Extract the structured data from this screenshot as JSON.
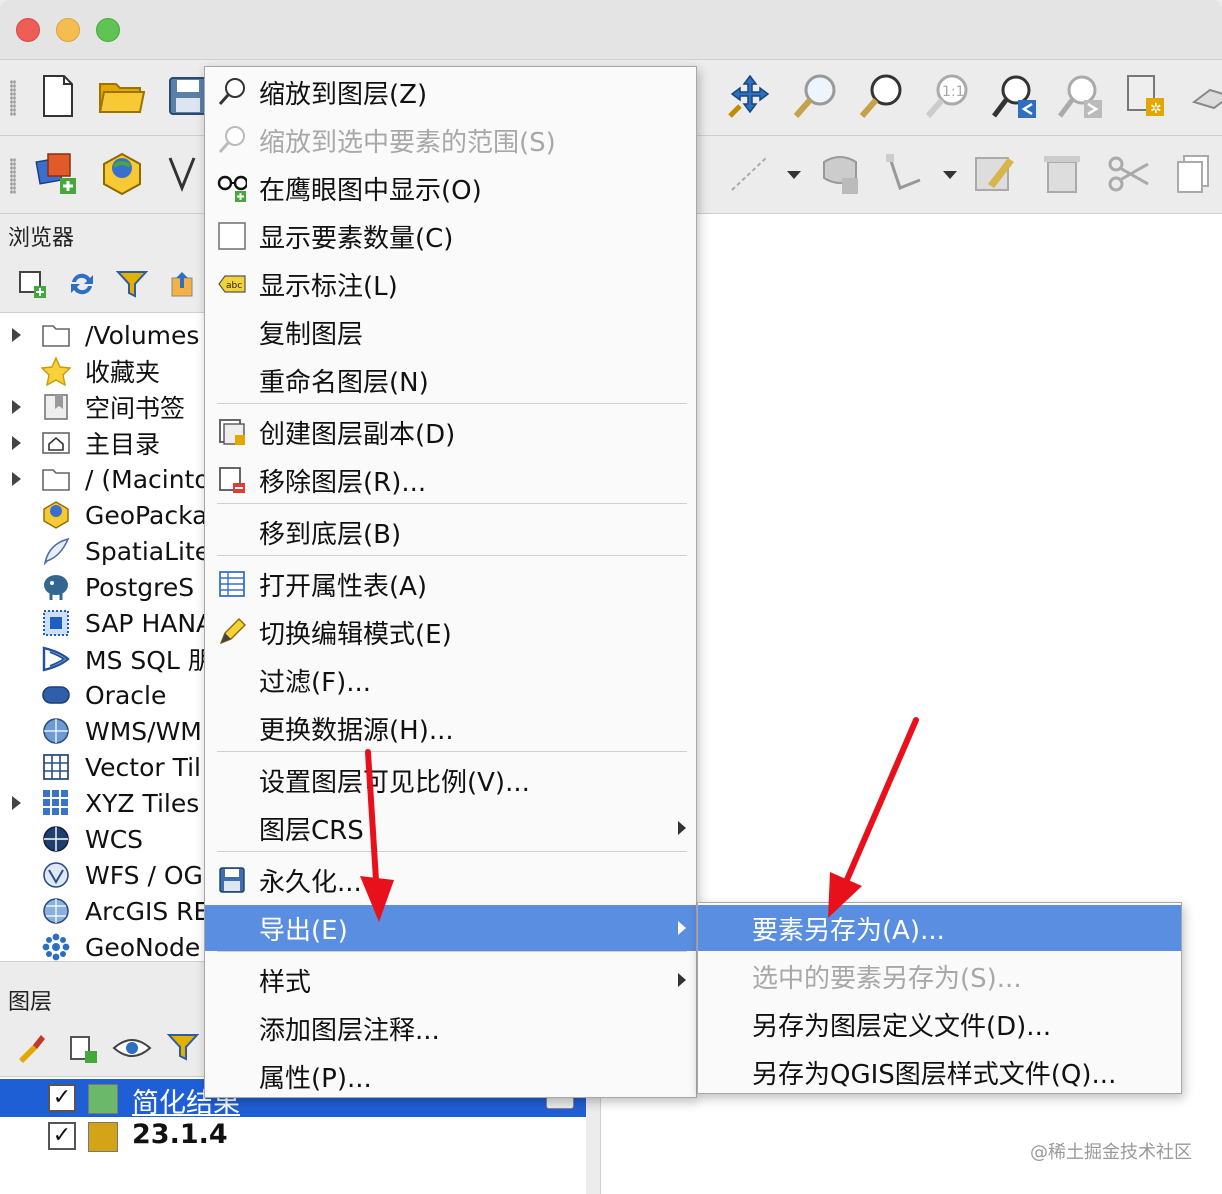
{
  "browser": {
    "title": "浏览器",
    "items": [
      {
        "label": "/Volumes",
        "icon": "folder-icon",
        "arrow": true
      },
      {
        "label": "收藏夹",
        "icon": "star-icon",
        "arrow": false
      },
      {
        "label": "空间书签",
        "icon": "bookmark-icon",
        "arrow": true
      },
      {
        "label": "主目录",
        "icon": "home-icon",
        "arrow": true
      },
      {
        "label": "/ (Macinto",
        "icon": "folder-icon",
        "arrow": true
      },
      {
        "label": "GeoPacka",
        "icon": "geopackage-icon",
        "arrow": false
      },
      {
        "label": "SpatiaLite",
        "icon": "feather-icon",
        "arrow": false
      },
      {
        "label": "PostgreS",
        "icon": "elephant-icon",
        "arrow": false
      },
      {
        "label": "SAP HANA",
        "icon": "hana-icon",
        "arrow": false
      },
      {
        "label": "MS SQL 朋",
        "icon": "mssql-icon",
        "arrow": false
      },
      {
        "label": "Oracle",
        "icon": "oracle-icon",
        "arrow": false
      },
      {
        "label": "WMS/WM",
        "icon": "wms-globe-icon",
        "arrow": false
      },
      {
        "label": "Vector Til",
        "icon": "grid-icon",
        "arrow": false
      },
      {
        "label": "XYZ Tiles",
        "icon": "tiles-icon",
        "arrow": true
      },
      {
        "label": "WCS",
        "icon": "wcs-globe-icon",
        "arrow": false
      },
      {
        "label": "WFS / OG",
        "icon": "wfs-globe-icon",
        "arrow": false
      },
      {
        "label": "ArcGIS RE",
        "icon": "arcgis-globe-icon",
        "arrow": false
      },
      {
        "label": "GeoNode",
        "icon": "geonode-icon",
        "arrow": false
      }
    ]
  },
  "layers": {
    "title": "图层",
    "items": [
      {
        "label": "简化结果",
        "color": "#6cb86a",
        "checked": true,
        "selected": true
      },
      {
        "label": "23.1.4",
        "color": "#d4a418",
        "checked": true,
        "selected": false
      }
    ]
  },
  "context_menu": {
    "items": [
      {
        "label": "缩放到图层(Z)",
        "icon": "zoom-layer-icon",
        "disabled": false
      },
      {
        "label": "缩放到选中要素的范围(S)",
        "icon": "zoom-selection-icon",
        "disabled": true
      },
      {
        "label": "在鹰眼图中显示(O)",
        "icon": "overview-glasses-icon",
        "disabled": false
      },
      {
        "label": "显示要素数量(C)",
        "icon": "checkbox-icon",
        "disabled": false
      },
      {
        "label": "显示标注(L)",
        "icon": "label-abc-icon",
        "disabled": false
      },
      {
        "label": "复制图层",
        "icon": "",
        "disabled": false
      },
      {
        "label": "重命名图层(N)",
        "icon": "",
        "disabled": false
      },
      {
        "label": "创建图层副本(D)",
        "icon": "duplicate-layer-icon",
        "disabled": false
      },
      {
        "label": "移除图层(R)...",
        "icon": "remove-layer-icon",
        "disabled": false
      },
      {
        "label": "移到底层(B)",
        "icon": "",
        "disabled": false
      },
      {
        "label": "打开属性表(A)",
        "icon": "attribute-table-icon",
        "disabled": false
      },
      {
        "label": "切换编辑模式(E)",
        "icon": "pencil-icon",
        "disabled": false
      },
      {
        "label": "过滤(F)...",
        "icon": "",
        "disabled": false
      },
      {
        "label": "更换数据源(H)...",
        "icon": "",
        "disabled": false
      },
      {
        "label": "设置图层可见比例(V)...",
        "icon": "",
        "disabled": false
      },
      {
        "label": "图层CRS",
        "icon": "",
        "disabled": false,
        "submenu": true
      },
      {
        "label": "永久化...",
        "icon": "save-icon",
        "disabled": false
      },
      {
        "label": "导出(E)",
        "icon": "",
        "disabled": false,
        "submenu": true,
        "selected": true
      },
      {
        "label": "样式",
        "icon": "",
        "disabled": false,
        "submenu": true
      },
      {
        "label": "添加图层注释...",
        "icon": "",
        "disabled": false
      },
      {
        "label": "属性(P)...",
        "icon": "",
        "disabled": false
      }
    ]
  },
  "export_submenu": {
    "items": [
      {
        "label": "要素另存为(A)...",
        "selected": true,
        "disabled": false
      },
      {
        "label": "选中的要素另存为(S)...",
        "selected": false,
        "disabled": true
      },
      {
        "label": "另存为图层定义文件(D)...",
        "selected": false,
        "disabled": false
      },
      {
        "label": "另存为QGIS图层样式文件(Q)...",
        "selected": false,
        "disabled": false
      }
    ]
  },
  "watermark": "@稀土掘金技术社区",
  "colors": {
    "highlight": "#5a8ee0",
    "arrow": "#e8111b"
  }
}
